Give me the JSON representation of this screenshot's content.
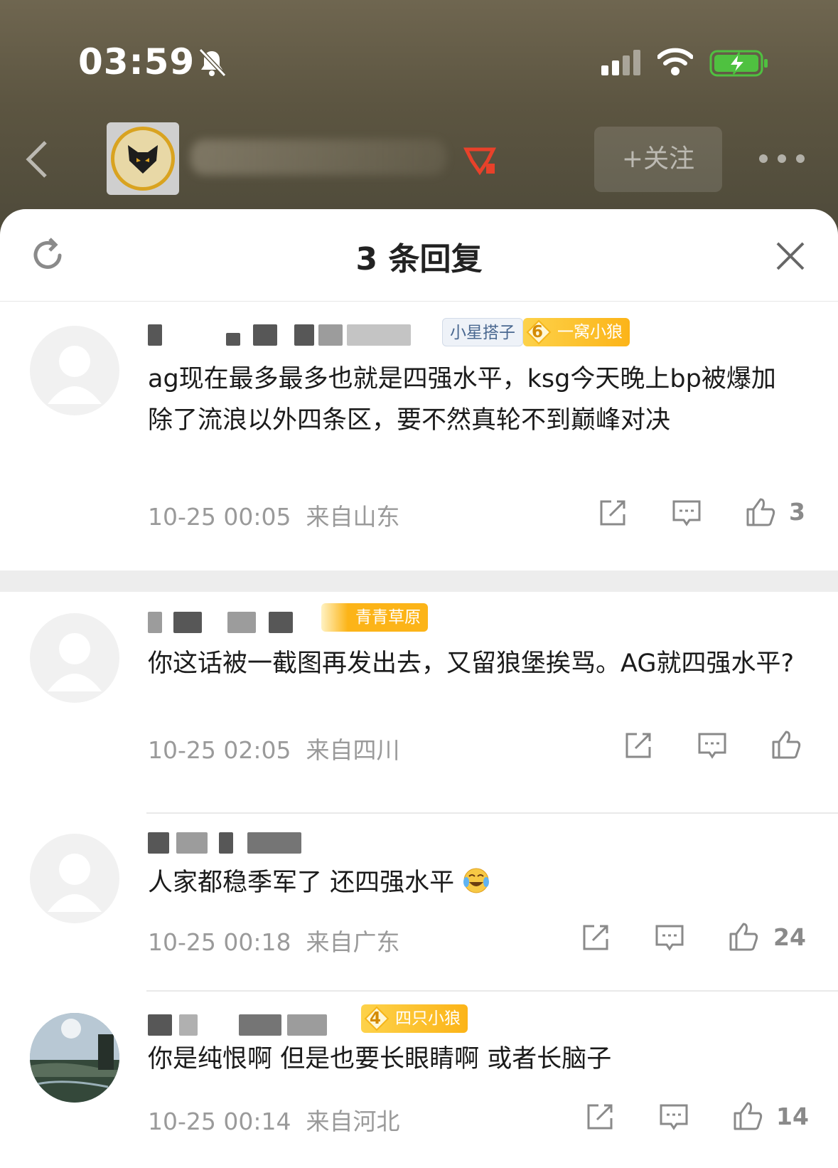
{
  "status_bar": {
    "time": "03:59"
  },
  "header": {
    "follow_label": "+关注"
  },
  "sheet": {
    "title": "3 条回复"
  },
  "main_comment": {
    "badges": [
      "小星搭子",
      "一窝小狼"
    ],
    "badge_level": "6",
    "text": "ag现在最多最多也就是四强水平，ksg今天晚上bp被爆加除了流浪以外四条区，要不然真轮不到巅峰对决",
    "time": "10-25 00:05",
    "location": "来自山东",
    "likes": "3"
  },
  "replies": [
    {
      "badge": "青青草原",
      "text": "你这话被一截图再发出去，又留狼堡挨骂。AG就四强水平?",
      "time": "10-25 02:05",
      "location": "来自四川",
      "likes": ""
    },
    {
      "badge": "",
      "text": "人家都稳季军了 还四强水平",
      "emoji": "crying-laughing-emoji",
      "time": "10-25 00:18",
      "location": "来自广东",
      "likes": "24"
    },
    {
      "badge": "四只小狼",
      "badge_level": "4",
      "text": "你是纯恨啊 但是也要长眼睛啊 或者长脑子",
      "time": "10-25 00:14",
      "location": "来自河北",
      "likes": "14"
    }
  ]
}
